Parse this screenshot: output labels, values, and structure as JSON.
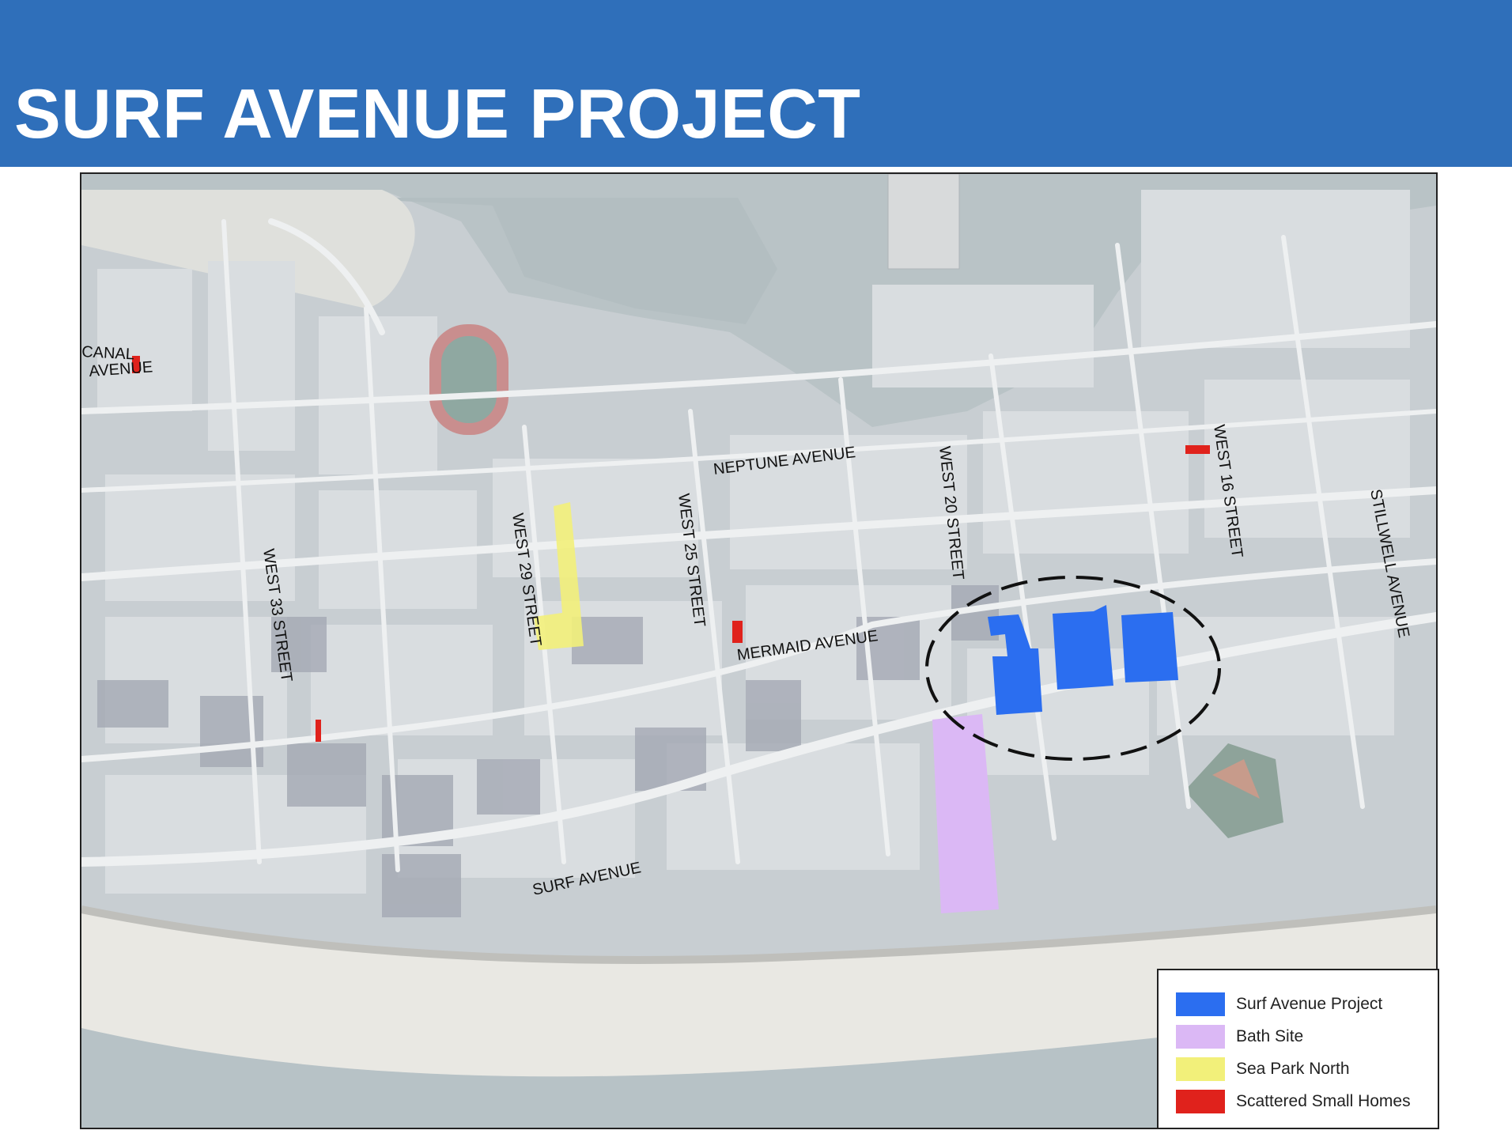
{
  "title": "SURF AVENUE PROJECT",
  "colors": {
    "header": "#2f6fba",
    "surf_avenue_project": "#2b6ef0",
    "bath_site": "#dbb8f5",
    "sea_park_north": "#f2f07a",
    "scattered_small_homes": "#e0221c"
  },
  "map": {
    "street_labels": {
      "canal_avenue_line1": "CANAL",
      "canal_avenue_line2": "AVENUE",
      "neptune_avenue": "NEPTUNE AVENUE",
      "west_33_street": "WEST 33 STREET",
      "west_29_street": "WEST 29 STREET",
      "west_25_street": "WEST 25 STREET",
      "mermaid_avenue": "MERMAID AVENUE",
      "west_20_street": "WEST 20 STREET",
      "west_16_street": "WEST 16 STREET",
      "stillwell_avenue": "STILLWELL AVENUE",
      "surf_avenue": "SURF AVENUE"
    }
  },
  "legend": {
    "items": [
      {
        "label": "Surf Avenue Project",
        "color": "#2b6ef0"
      },
      {
        "label": "Bath Site",
        "color": "#dbb8f5"
      },
      {
        "label": "Sea Park North",
        "color": "#f2f07a"
      },
      {
        "label": "Scattered Small Homes",
        "color": "#e0221c"
      }
    ]
  }
}
